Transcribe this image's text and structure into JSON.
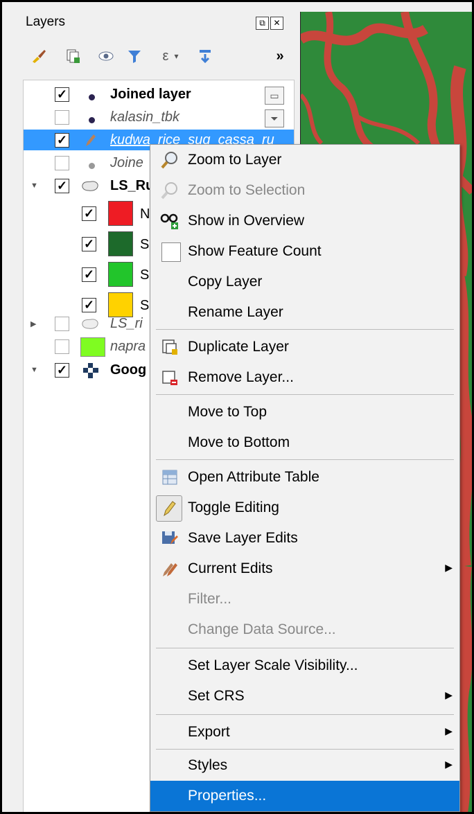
{
  "panel": {
    "title": "Layers",
    "float_button": "⧉",
    "close_button": "✕",
    "toolbar_overflow": "»"
  },
  "layers": [
    {
      "label": "Joined layer",
      "checked": true,
      "style": "bold"
    },
    {
      "label": "kalasin_tbk",
      "checked": false,
      "style": "italic"
    },
    {
      "label": "kudwa_rice_sug_cassa_ru",
      "checked": true,
      "style": "selected"
    },
    {
      "label": "Joine",
      "checked": false,
      "style": "italic"
    },
    {
      "label": "LS_Ru",
      "checked": true,
      "style": "bold"
    },
    {
      "label": "N",
      "checked": true,
      "color": "#ee1c24"
    },
    {
      "label": "S",
      "checked": true,
      "color": "#1d6a2b"
    },
    {
      "label": "S",
      "checked": true,
      "color": "#22c52b"
    },
    {
      "label": "S",
      "checked": true,
      "color": "#ffd200"
    },
    {
      "label": "LS_ri",
      "checked": false,
      "style": "italic"
    },
    {
      "label": "napra",
      "checked": false,
      "style": "italic",
      "color": "#7ffc21"
    },
    {
      "label": "Goog",
      "checked": true,
      "style": "bold"
    }
  ],
  "menu": {
    "zoom_layer": "Zoom to Layer",
    "zoom_selection": "Zoom to Selection",
    "show_overview": "Show in Overview",
    "show_feature_count": "Show Feature Count",
    "copy_layer": "Copy Layer",
    "rename_layer": "Rename Layer",
    "duplicate_layer": "Duplicate Layer",
    "remove_layer": "Remove Layer...",
    "move_top": "Move to Top",
    "move_bottom": "Move to Bottom",
    "open_attr_table": "Open Attribute Table",
    "toggle_editing": "Toggle Editing",
    "save_edits": "Save Layer Edits",
    "current_edits": "Current Edits",
    "filter": "Filter...",
    "change_source": "Change Data Source...",
    "set_scale_visibility": "Set Layer Scale Visibility...",
    "set_crs": "Set CRS",
    "export": "Export",
    "styles": "Styles",
    "properties": "Properties..."
  },
  "colors": {
    "selection": "#3399ff",
    "menu_highlight": "#0a75d6",
    "map_green": "#2f8a3a",
    "map_red": "#c8463c"
  }
}
